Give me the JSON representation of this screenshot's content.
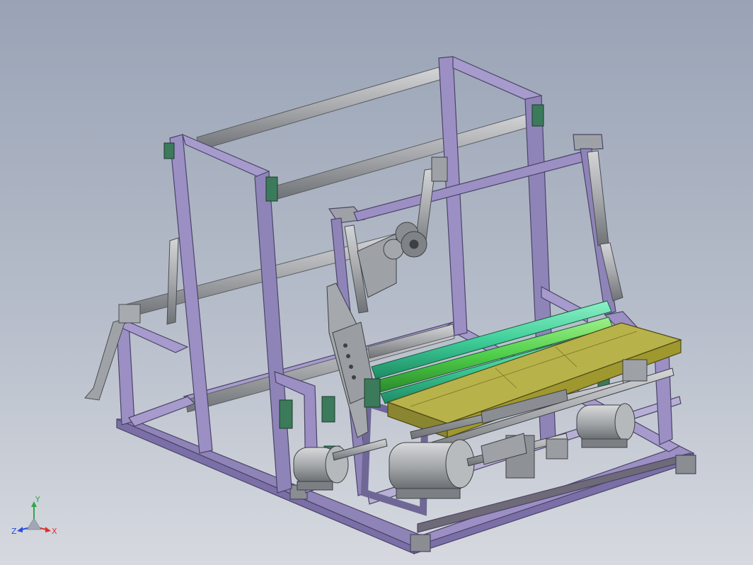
{
  "viewport": {
    "background_top": "#99a3b5",
    "background_bottom": "#d6d9df"
  },
  "model": {
    "frame_color": "#9b8fc4",
    "shaft_color": "#a9abae",
    "roller_color": "#3fcf9a",
    "table_color": "#b3ad3e",
    "bearing_color": "#3b7a5a",
    "motor_color": "#9fa3a6"
  },
  "triad": {
    "x_label": "X",
    "y_label": "Y",
    "z_label": "Z",
    "x_color": "#e0302a",
    "y_color": "#2fa84a",
    "z_color": "#2a4fd8",
    "icon": "coordinate-triad-icon"
  }
}
